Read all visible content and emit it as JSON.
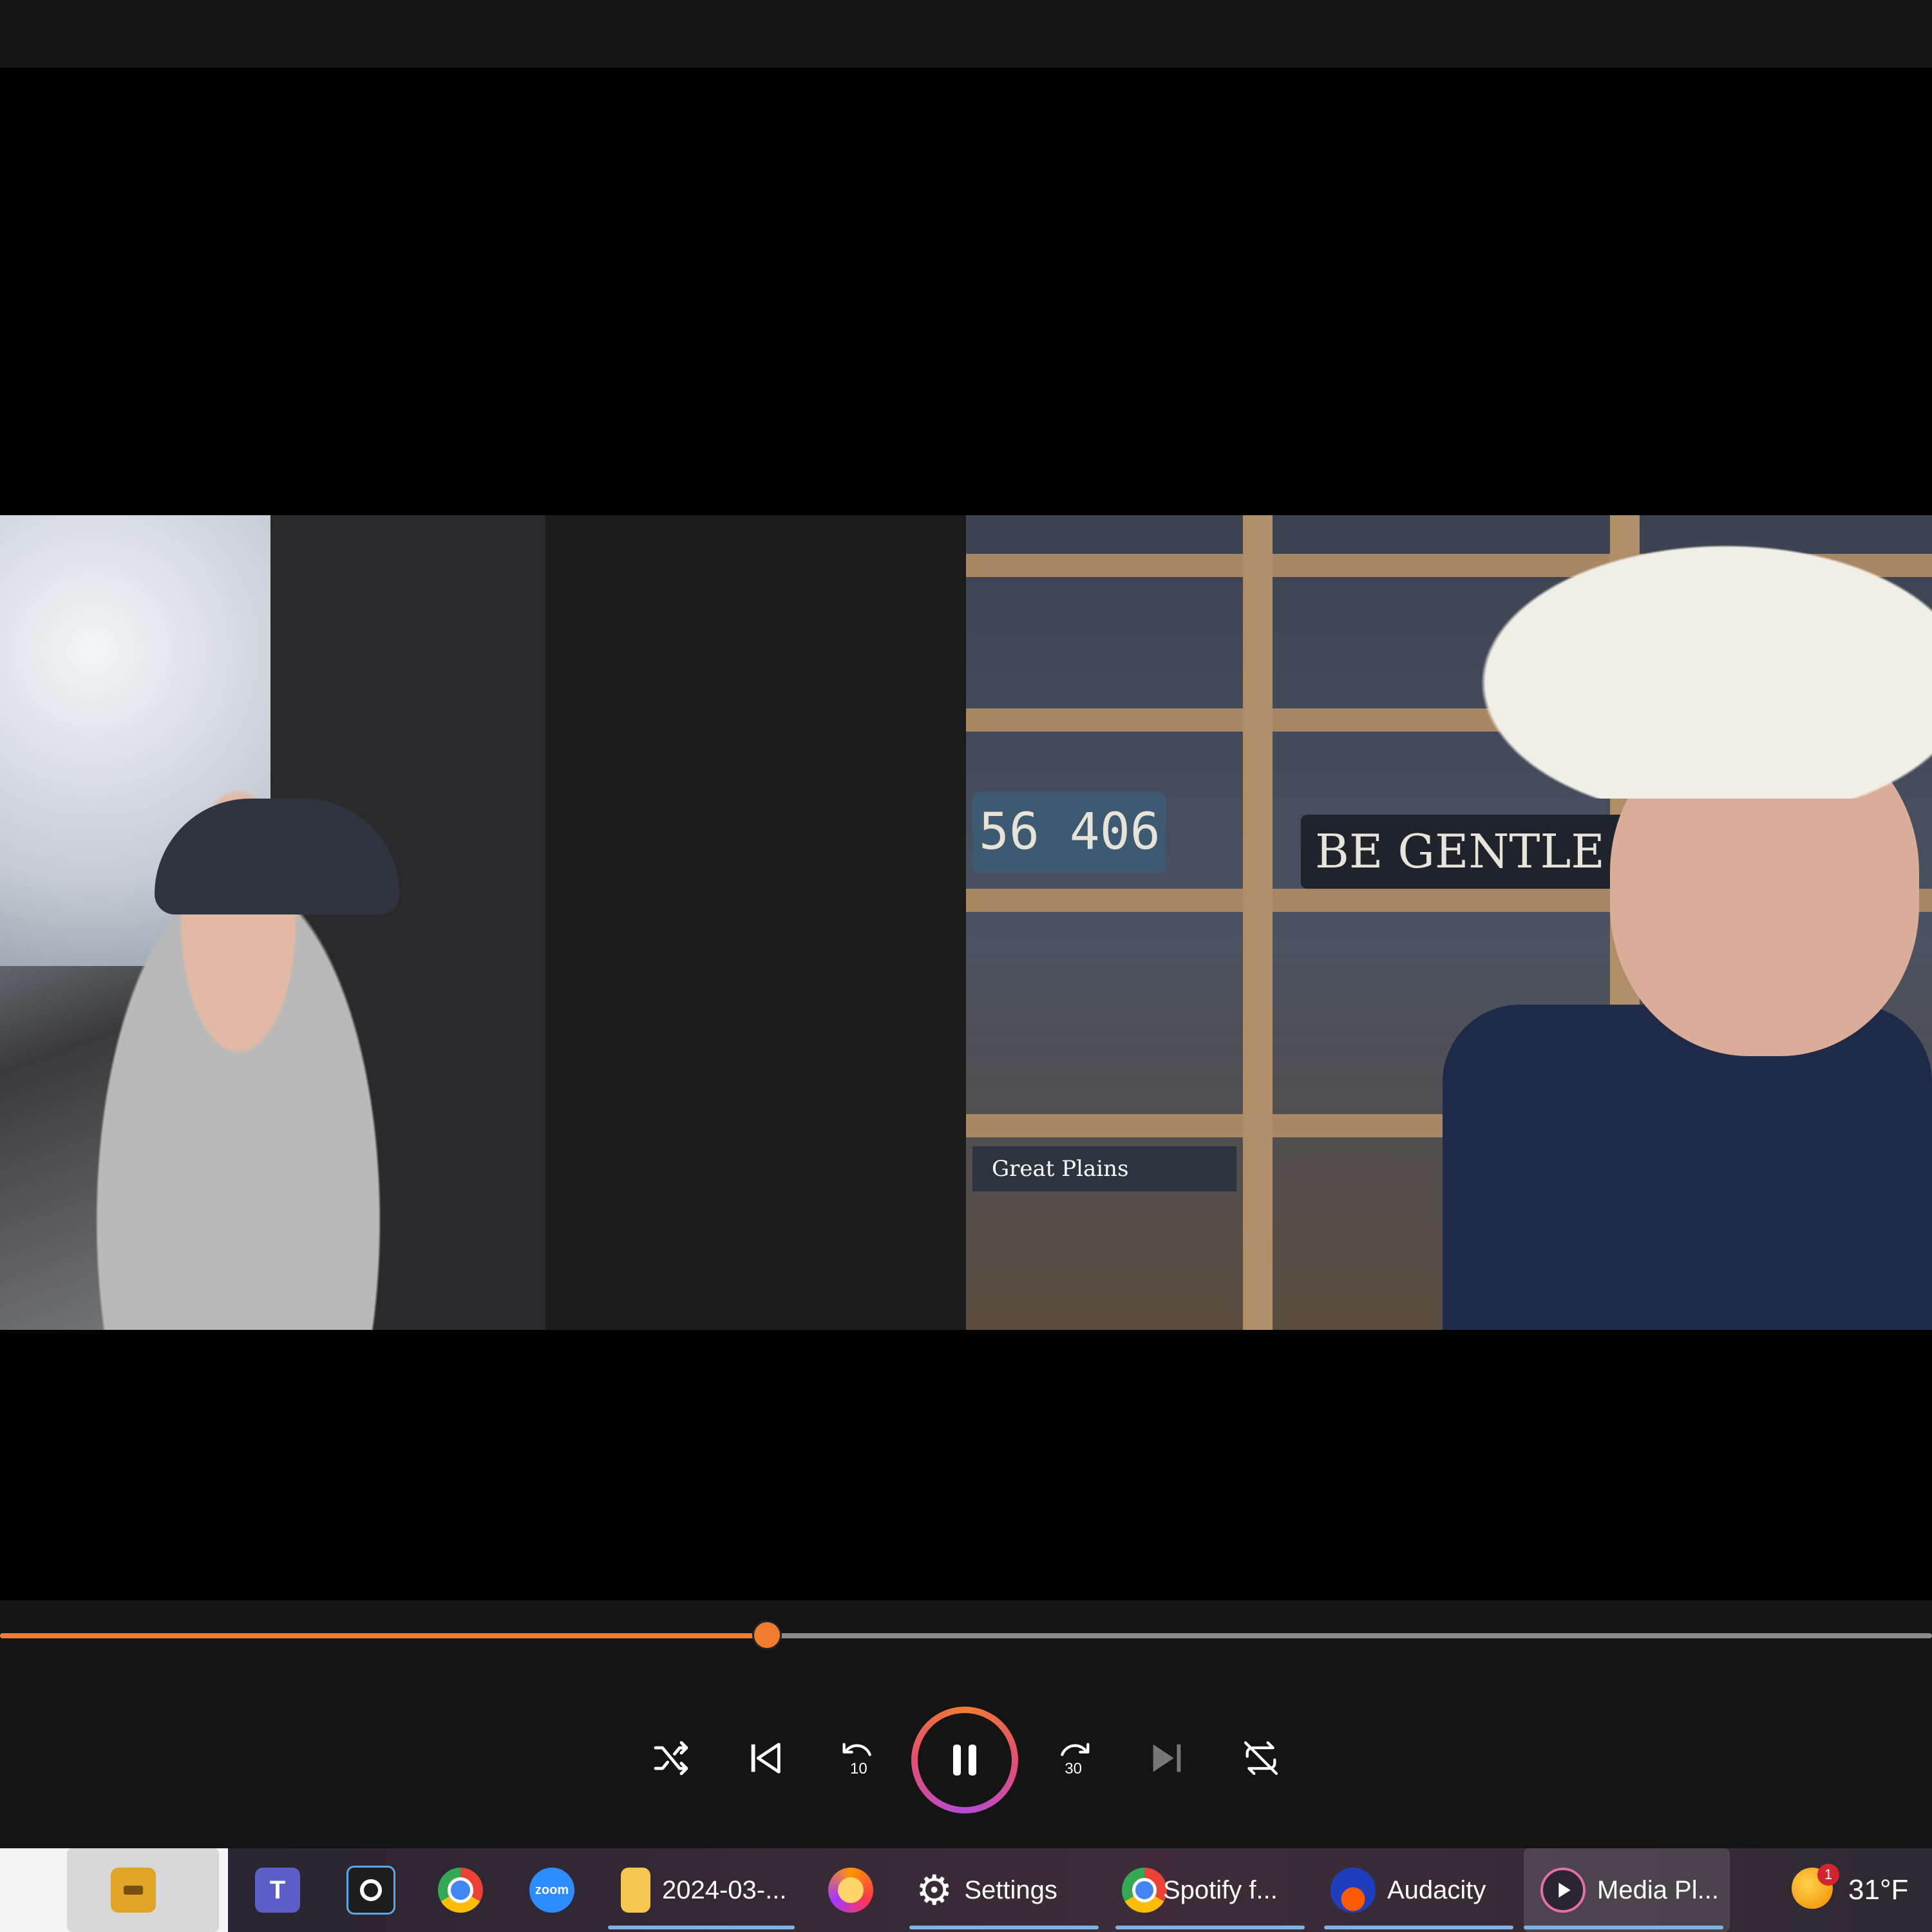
{
  "video": {
    "left_participant": {
      "description": "man in gray hoodie and cap in vehicle"
    },
    "right_participant": {
      "sign_text": "BE GENTLE STAY FI",
      "plate_text": "56 406",
      "book_text": "Great Plains"
    }
  },
  "player": {
    "progress_fraction": 0.397,
    "controls": {
      "shuffle": "shuffle-icon",
      "previous": "previous-icon",
      "skip_back": "10",
      "pause": "pause-icon",
      "skip_forward": "30",
      "next": "next-icon",
      "repeat": "repeat-icon"
    },
    "accent_color": "#f07c2f"
  },
  "taskbar": {
    "items": [
      {
        "name": "work-briefcase",
        "label": ""
      },
      {
        "name": "teams",
        "label": ""
      },
      {
        "name": "quick-assist",
        "label": ""
      },
      {
        "name": "chrome",
        "label": ""
      },
      {
        "name": "zoom",
        "label": "",
        "icon_text": "zoom"
      },
      {
        "name": "file-explorer",
        "label": "2024-03-..."
      },
      {
        "name": "firefox",
        "label": ""
      },
      {
        "name": "settings",
        "label": "Settings"
      },
      {
        "name": "chrome-spotify",
        "label": "Spotify f..."
      },
      {
        "name": "audacity",
        "label": "Audacity"
      },
      {
        "name": "media-player",
        "label": "Media Pl..."
      }
    ],
    "weather": {
      "temp": "31°F",
      "badge": "1"
    }
  }
}
